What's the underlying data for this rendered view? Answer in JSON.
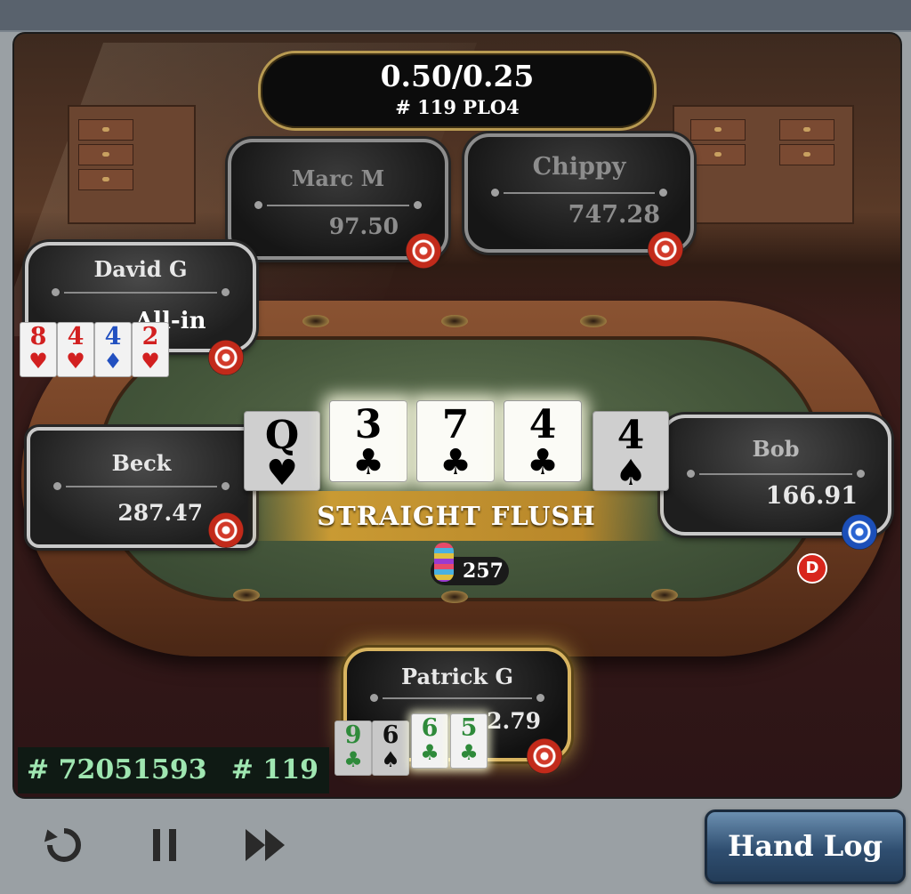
{
  "header": {
    "stakes": "0.50/0.25",
    "game": "# 119 PLO4"
  },
  "players": {
    "marc": {
      "name": "Marc M",
      "stack": "97.50"
    },
    "chippy": {
      "name": "Chippy",
      "stack": "747.28"
    },
    "david": {
      "name": "David G",
      "status": "All-in",
      "cards": [
        {
          "rank": "8",
          "suit": "♥"
        },
        {
          "rank": "4",
          "suit": "♥"
        },
        {
          "rank": "4",
          "suit": "♦"
        },
        {
          "rank": "2",
          "suit": "♥"
        }
      ]
    },
    "beck": {
      "name": "Beck",
      "stack": "287.47"
    },
    "bob": {
      "name": "Bob",
      "stack": "166.91"
    },
    "patrick": {
      "name": "Patrick G",
      "stack": "...2.79",
      "cards": [
        {
          "rank": "9",
          "suit": "♣"
        },
        {
          "rank": "6",
          "suit": "♠"
        },
        {
          "rank": "6",
          "suit": "♣"
        },
        {
          "rank": "5",
          "suit": "♣"
        }
      ]
    }
  },
  "board": [
    {
      "rank": "Q",
      "suit": "♥"
    },
    {
      "rank": "3",
      "suit": "♣"
    },
    {
      "rank": "7",
      "suit": "♣"
    },
    {
      "rank": "4",
      "suit": "♣"
    },
    {
      "rank": "4",
      "suit": "♠"
    }
  ],
  "hand_result": "STRAIGHT FLUSH",
  "pot": "257",
  "dealer_button": "D",
  "hand_info": {
    "hand_id": "# 72051593",
    "hand_number": "# 119"
  },
  "controls": {
    "replay_icon": "replay-icon",
    "pause_icon": "pause-icon",
    "fast_forward_icon": "fast-forward-icon",
    "hand_log_label": "Hand Log"
  },
  "colors": {
    "hearts": "#d22020",
    "diamonds": "#2250c0",
    "clubs": "#2e8a3a",
    "spades": "#111111",
    "winner_glow": "#d8b460",
    "hand_id_text": "#9fe6b1"
  }
}
